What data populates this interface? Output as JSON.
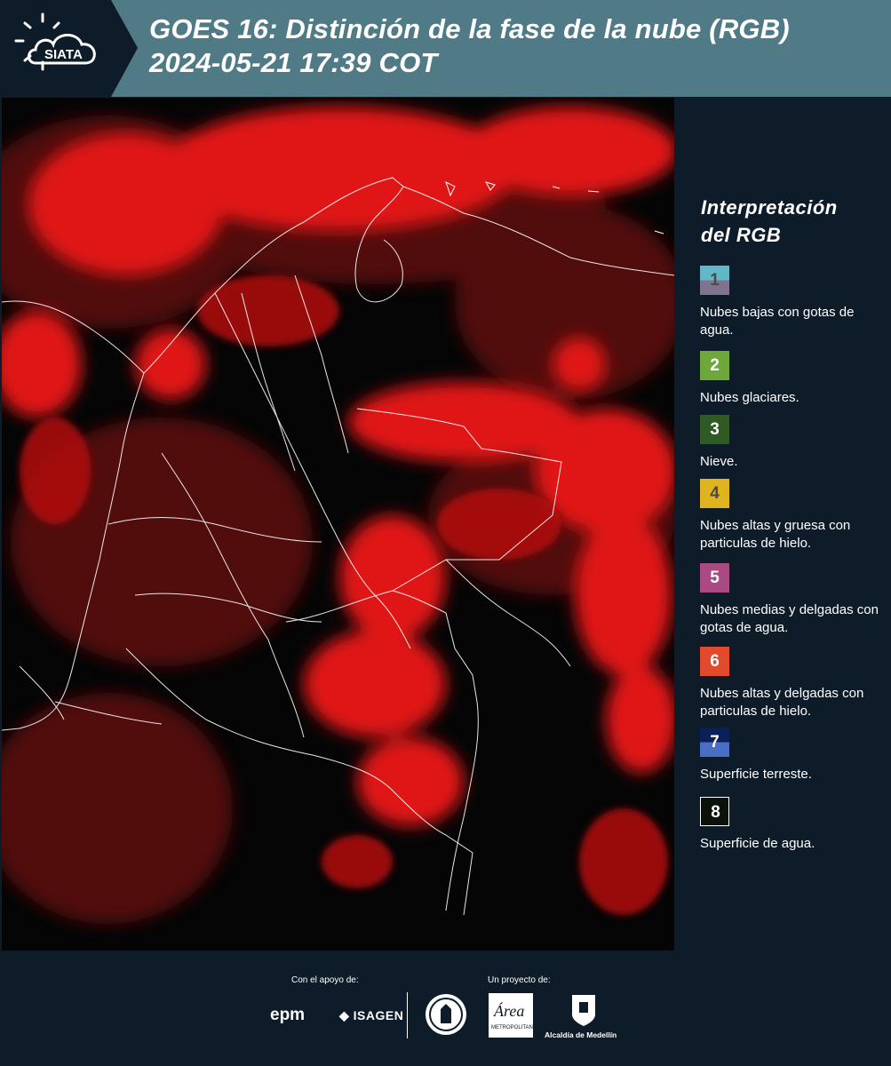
{
  "header": {
    "brand": "SIATA",
    "title_line1": "GOES 16: Distinción de la fase de la nube (RGB)",
    "title_line2": " 2024-05-21 17:39 COT"
  },
  "map": {
    "description_icon": "satellite-rgb-image-colombia"
  },
  "legend": {
    "title_line1": "Interpretación",
    "title_line2": "del RGB",
    "items": [
      {
        "num": "1",
        "label": "Nubes bajas con gotas de agua.",
        "color_top": "#62b8c6",
        "color_bottom": "#7e7490"
      },
      {
        "num": "2",
        "label": "Nubes glaciares.",
        "color_top": "#6ea83b",
        "color_bottom": "#6ea83b"
      },
      {
        "num": "3",
        "label": "Nieve.",
        "color_top": "#2f5a23",
        "color_bottom": "#2f5a23"
      },
      {
        "num": "4",
        "label": "Nubes altas y gruesa con particulas de hielo.",
        "color_top": "#e0b320",
        "color_bottom": "#e0b320"
      },
      {
        "num": "5",
        "label": "Nubes medias y delgadas con gotas de agua.",
        "color_top": "#a94a82",
        "color_bottom": "#a94a82"
      },
      {
        "num": "6",
        "label": "Nubes altas y delgadas con particulas de hielo.",
        "color_top": "#e14a2b",
        "color_bottom": "#e14a2b"
      },
      {
        "num": "7",
        "label": "Superficie terreste.",
        "color_top": "#0d1f5a",
        "color_bottom": "#4a6ec4"
      },
      {
        "num": "8",
        "label": "Superficie de agua.",
        "color_top": "#0a120a",
        "color_bottom": "#0a120a"
      }
    ]
  },
  "footer": {
    "support_label": "Con el apoyo de:",
    "project_label": "Un proyecto de:",
    "sponsor1": "epm",
    "sponsor2": "ISAGEN",
    "partner1": "Área Metropolitana Valle de Aburrá",
    "partner2": "Alcaldía de Medellín"
  }
}
